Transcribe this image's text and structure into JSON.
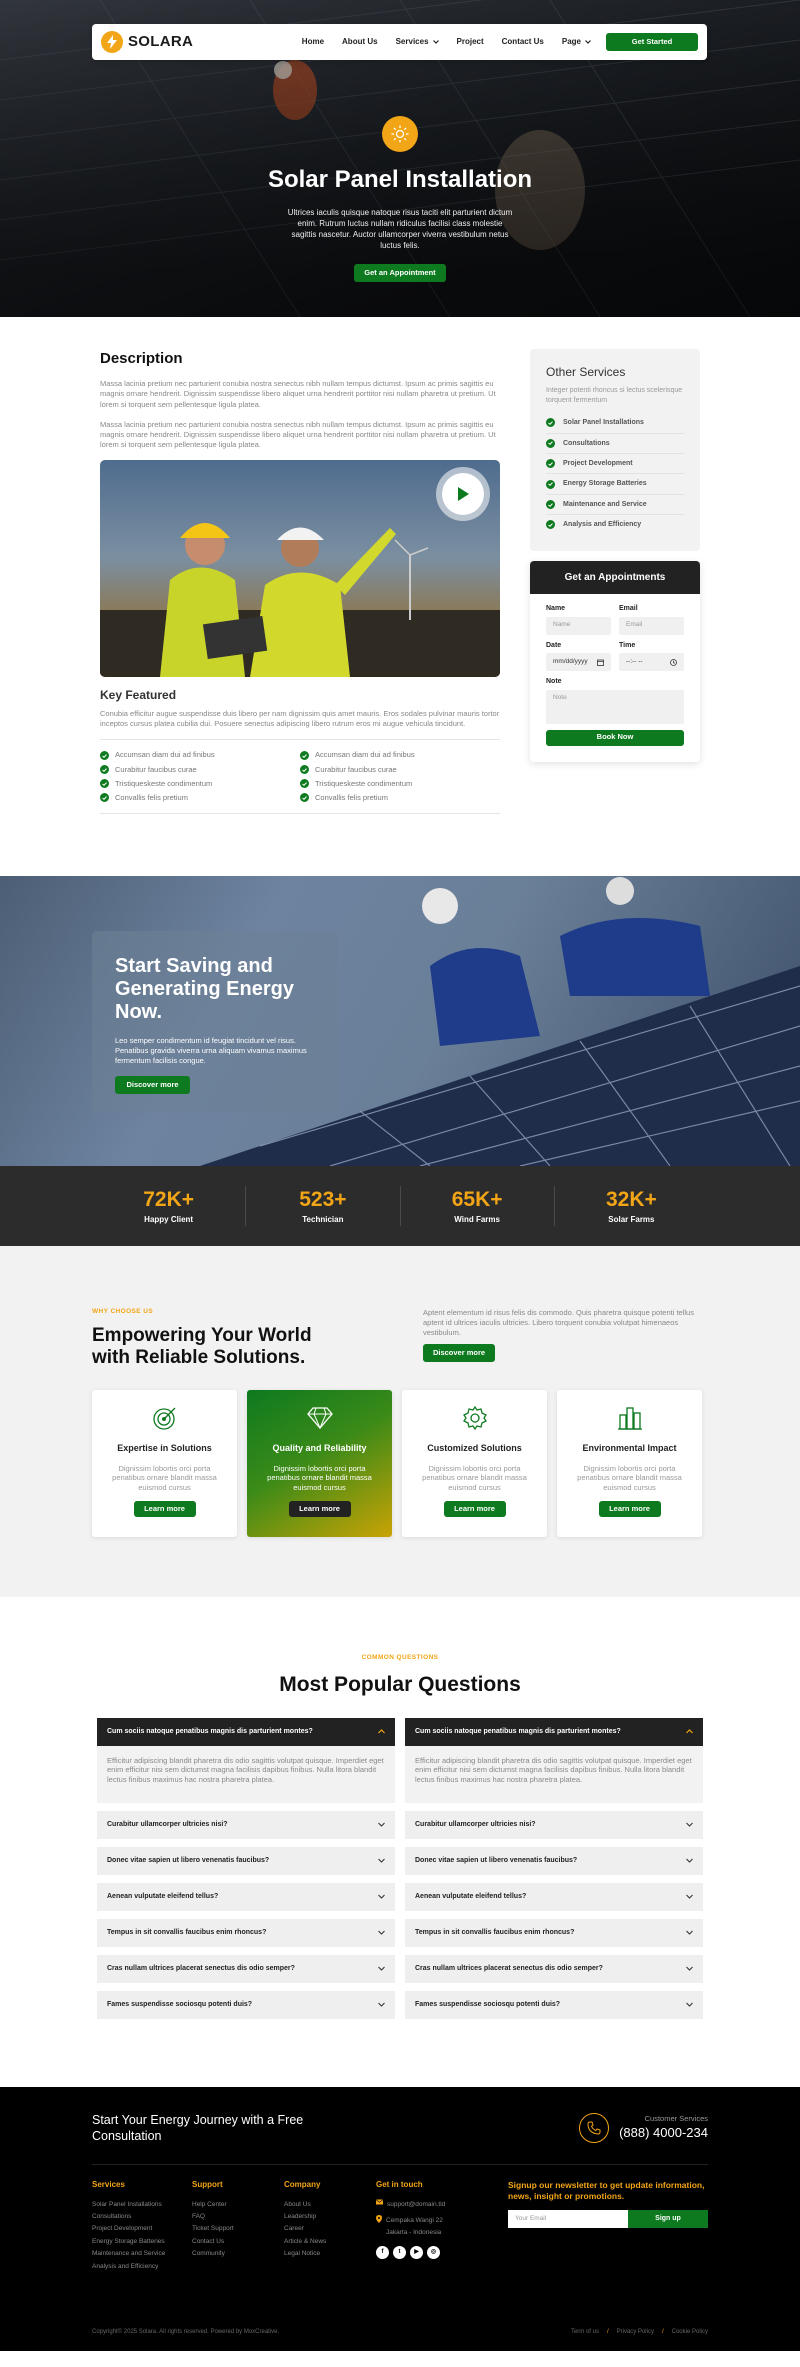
{
  "nav": {
    "logo": "SOLARA",
    "items": [
      "Home",
      "About Us",
      "Services",
      "Project",
      "Contact Us",
      "Page"
    ],
    "cta": "Get Started"
  },
  "hero": {
    "title": "Solar Panel Installation",
    "text": "Ultrices iaculis quisque natoque risus taciti elit parturient dictum enim. Rutrum luctus nullam ridiculus facilisi class molestie sagittis nascetur. Auctor ullamcorper viverra vestibulum netus luctus felis.",
    "cta": "Get an Appointment"
  },
  "description": {
    "title": "Description",
    "p1": "Massa lacinia pretium nec parturient conubia nostra senectus nibh nullam tempus dictumst. Ipsum ac primis sagittis eu magnis ornare hendrerit. Dignissim suspendisse libero aliquet urna hendrerit porttitor nisi nullam pharetra ut pretium. Ut lorem si torquent sem pellentesque ligula platea.",
    "p2": "Massa lacinia pretium nec parturient conubia nostra senectus nibh nullam tempus dictumst. Ipsum ac primis sagittis eu magnis ornare hendrerit. Dignissim suspendisse libero aliquet urna hendrerit porttitor nisi nullam pharetra ut pretium. Ut lorem si torquent sem pellentesque ligula platea.",
    "kf_title": "Key Featured",
    "kf_text": "Conubia efficitur augue suspendisse duis libero per nam dignissim quis amet mauris. Eros sodales pulvinar mauris tortor inceptos cursus platea cubilia dui. Posuere senectus adipiscing libero rutrum eros mi augue vehicula tincidunt.",
    "features": [
      "Accumsan diam dui ad finibus",
      "Accumsan diam dui ad finibus",
      "Curabitur faucibus curae",
      "Curabitur faucibus curae",
      "Tristiqueskeste condimentum",
      "Tristiqueskeste condimentum",
      "Convallis felis pretium",
      "Convallis felis pretium"
    ]
  },
  "sidebar": {
    "title": "Other Services",
    "sub": "Integer potenti rhoncus si lectus scelerisque torquent fermentum",
    "services": [
      "Solar Panel Installations",
      "Consultations",
      "Project Development",
      "Energy Storage Batteries",
      "Maintenance and Service",
      "Analysis and Efficiency"
    ]
  },
  "appointment": {
    "title": "Get an Appointments",
    "name_label": "Name",
    "name_ph": "Name",
    "email_label": "Email",
    "email_ph": "Email",
    "date_label": "Date",
    "date_ph": "mm/dd/yyyy",
    "time_label": "Time",
    "time_ph": "--:-- --",
    "note_label": "Note",
    "note_ph": "Note",
    "button": "Book Now"
  },
  "banner": {
    "title": "Start Saving and Generating Energy Now.",
    "text": "Leo semper condimentum id feugiat tincidunt vel risus. Penatibus gravida viverra urna aliquam vivamus maximus fermentum facilisis congue.",
    "cta": "Discover more"
  },
  "stats": [
    {
      "value": "72K+",
      "label": "Happy Client"
    },
    {
      "value": "523+",
      "label": "Technician"
    },
    {
      "value": "65K+",
      "label": "Wind Farms"
    },
    {
      "value": "32K+",
      "label": "Solar Farms"
    }
  ],
  "why": {
    "kicker": "WHY CHOOSE US",
    "title": "Empowering Your World with Reliable Solutions.",
    "text": "Aptent elementum id risus felis dis commodo. Quis pharetra quisque potenti tellus aptent id ultrices iaculis ultricies. Libero torquent conubia volutpat himenaeos vestibulum.",
    "cta": "Discover more",
    "cards": [
      {
        "title": "Expertise in Solutions",
        "text": "Dignissim lobortis orci porta penatibus ornare blandit massa euismod cursus",
        "button": "Learn more"
      },
      {
        "title": "Quality and Reliability",
        "text": "Dignissim lobortis orci porta penatibus ornare blandit massa euismod cursus",
        "button": "Learn more"
      },
      {
        "title": "Customized Solutions",
        "text": "Dignissim lobortis orci porta penatibus ornare blandit massa euismod cursus",
        "button": "Learn more"
      },
      {
        "title": "Environmental Impact",
        "text": "Dignissim lobortis orci porta penatibus ornare blandit massa euismod cursus",
        "button": "Learn more"
      }
    ]
  },
  "faq": {
    "kicker": "COMMON QUESTIONS",
    "title": "Most Popular Questions",
    "open_q": "Cum sociis natoque penatibus magnis dis parturient montes?",
    "open_a": "Efficitur adipiscing blandit pharetra dis odio sagittis volutpat quisque. Imperdiet eget enim efficitur nisi sem dictumst magna facilisis dapibus finibus. Nulla litora blandit lectus finibus maximus hac nostra pharetra platea.",
    "questions": [
      "Curabitur ullamcorper ultricies nisi?",
      "Donec vitae sapien ut libero venenatis faucibus?",
      "Aenean vulputate eleifend tellus?",
      "Tempus in sit convallis faucibus enim rhoncus?",
      "Cras nullam ultrices placerat senectus dis odio semper?",
      "Fames suspendisse sociosqu potenti duis?"
    ]
  },
  "footer": {
    "cta_title": "Start Your Energy Journey with a Free Consultation",
    "service_label": "Customer Services",
    "phone": "(888) 4000-234",
    "services_title": "Services",
    "services": [
      "Solar Panel Installations",
      "Consultations",
      "Project Development",
      "Energy Storage Batteries",
      "Maintenance and Service",
      "Analysis and Efficiency"
    ],
    "support_title": "Support",
    "support": [
      "Help Center",
      "FAQ",
      "Ticket Support",
      "Contact Us",
      "Community"
    ],
    "company_title": "Company",
    "company": [
      "About Us",
      "Leadership",
      "Career",
      "Article & News",
      "Legal Notice"
    ],
    "touch_title": "Get in touch",
    "email": "support@domain.tld",
    "address": "Cempaka Wangi 22 Jakarta - Indonesia",
    "news_title": "Signup our newsletter to get update information, news, insight or promotions.",
    "news_ph": "Your Email",
    "news_btn": "Sign up",
    "copyright": "Copyright© 2025 Solara. All rights reserved. Powered by MoxCreative.",
    "legal": [
      "Term of us",
      "Privacy Policy",
      "Cookie Policy"
    ]
  },
  "colors": {
    "brand_green": "#0e7a1f",
    "accent_orange": "#f2a516",
    "dark": "#222222"
  }
}
